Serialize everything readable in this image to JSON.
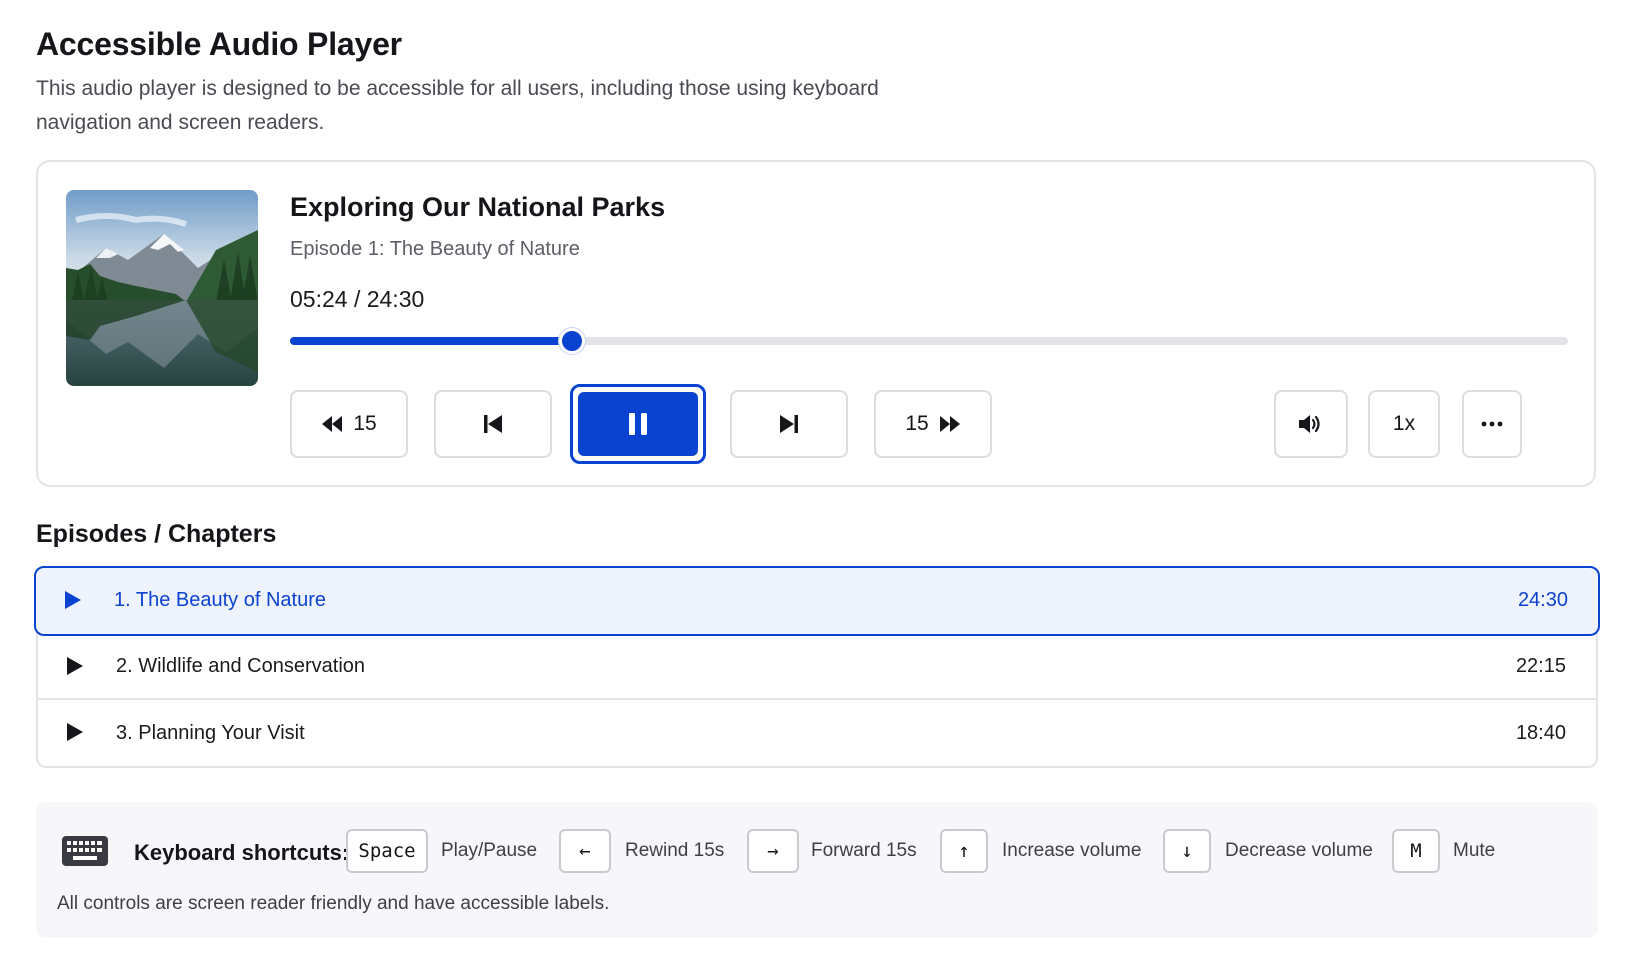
{
  "header": {
    "title": "Accessible Audio Player",
    "description": "This audio player is designed to be accessible for all users, including those using keyboard navigation and screen readers."
  },
  "player": {
    "cover_alt": "mountain-lake-artwork",
    "title": "Exploring Our National Parks",
    "subtitle": "Episode 1: The Beauty of Nature",
    "time": "05:24 / 24:30",
    "progress": 0.2204,
    "rewind_label": "15",
    "forward_label": "15",
    "speed_label": "1x",
    "state": "playing"
  },
  "episodes_section": {
    "title": "Episodes / Chapters",
    "items": [
      {
        "label": "1. The Beauty of Nature",
        "duration": "24:30",
        "active": true
      },
      {
        "label": "2. Wildlife and Conservation",
        "duration": "22:15",
        "active": false
      },
      {
        "label": "3. Planning Your Visit",
        "duration": "18:40",
        "active": false
      }
    ]
  },
  "shortcuts": {
    "title": "Keyboard shortcuts:",
    "items": [
      {
        "key": "Space",
        "action": "Play/Pause"
      },
      {
        "key": "←",
        "action": "Rewind 15s"
      },
      {
        "key": "→",
        "action": "Forward 15s"
      },
      {
        "key": "↑",
        "action": "Increase volume"
      },
      {
        "key": "↓",
        "action": "Decrease volume"
      },
      {
        "key": "M",
        "action": "Mute"
      }
    ],
    "note": "All controls are screen reader friendly and have accessible labels."
  },
  "colors": {
    "accent": "#0b43d1",
    "active_row_bg": "#eef3fd",
    "border": "#e3e3e8"
  },
  "icons": [
    "rewind-icon",
    "skip-previous-icon",
    "pause-icon",
    "skip-next-icon",
    "fast-forward-icon",
    "volume-icon",
    "more-icon",
    "play-icon",
    "keyboard-icon"
  ]
}
